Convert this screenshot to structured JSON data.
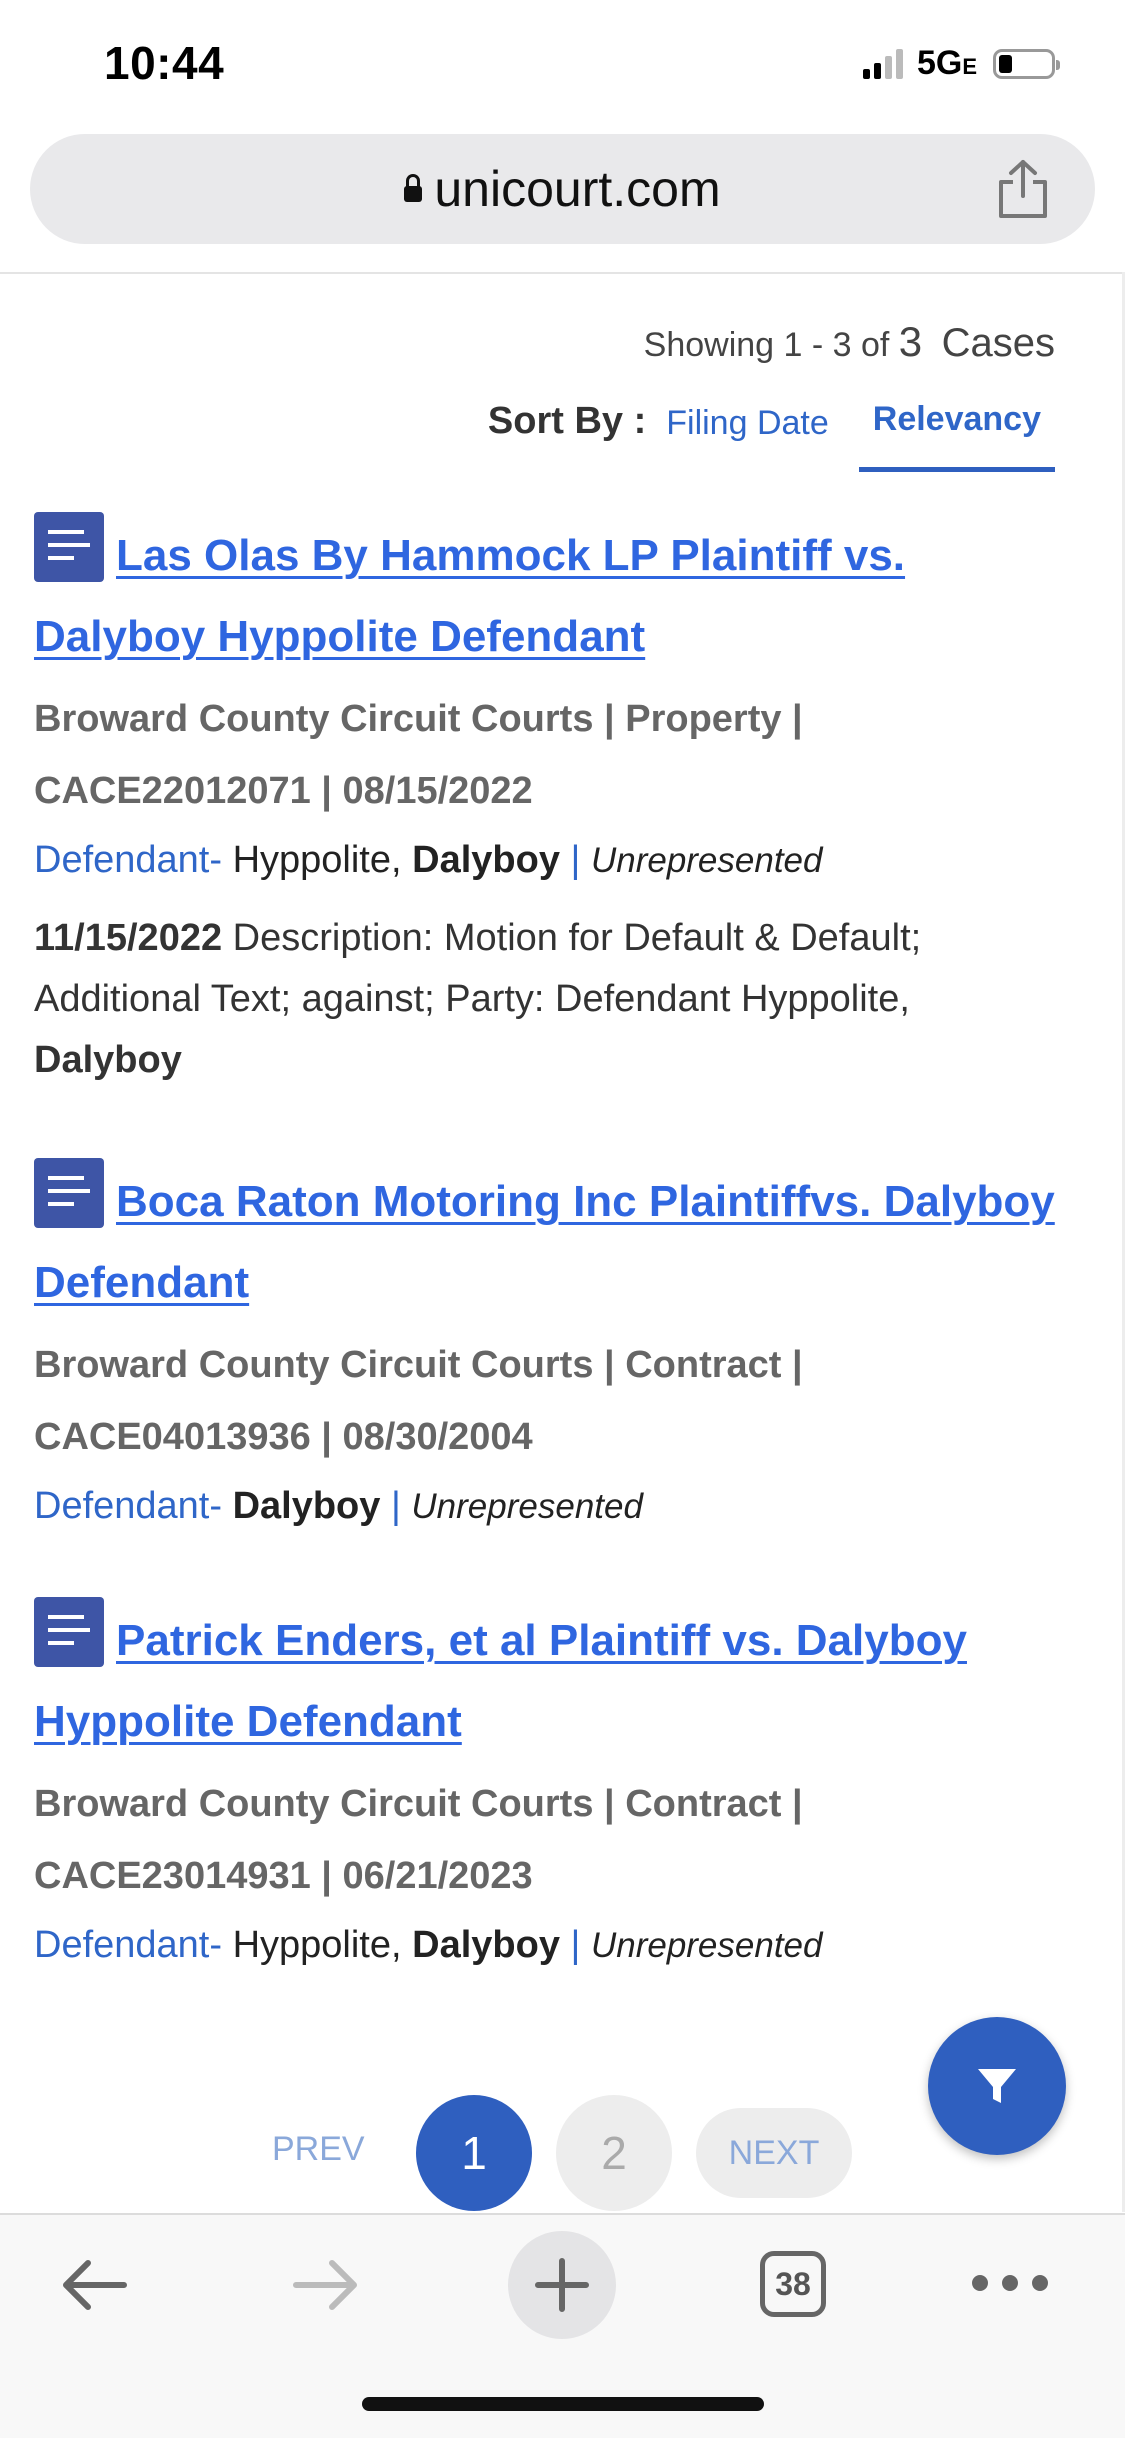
{
  "status_bar": {
    "time": "10:44",
    "network": "5G",
    "network_suffix": "E"
  },
  "browser": {
    "url": "unicourt.com"
  },
  "results": {
    "showing_prefix": "Showing 1 - 3 of",
    "total": "3",
    "unit": "Cases",
    "sort_label": "Sort By :",
    "sort_options": [
      "Filing Date",
      "Relevancy"
    ],
    "active_sort": "Relevancy"
  },
  "cases": [
    {
      "title_line1": "Las Olas By Hammock LP Plaintiff vs.",
      "title_line2": "Dalyboy Hyppolite Defendant",
      "court": "Broward County Circuit Courts",
      "category": "Property",
      "case_number": "CACE22012071",
      "date": "08/15/2022",
      "role": "Defendant-",
      "party_prefix": "Hyppolite,",
      "party_bold": "Dalyboy",
      "representation": "Unrepresented",
      "entry_date": "11/15/2022",
      "entry_line1": "Description: Motion for Default & Default;",
      "entry_line2": "Additional Text; against; Party: Defendant Hyppolite,",
      "entry_line3": "Dalyboy"
    },
    {
      "title_line1": "Boca Raton Motoring Inc Plaintiffvs. Dalyboy",
      "title_line2": "Defendant",
      "court": "Broward County Circuit Courts",
      "category": "Contract",
      "case_number": "CACE04013936",
      "date": "08/30/2004",
      "role": "Defendant-",
      "party_prefix": "",
      "party_bold": "Dalyboy",
      "representation": "Unrepresented"
    },
    {
      "title_line1": "Patrick Enders, et al Plaintiff vs. Dalyboy",
      "title_line2": "Hyppolite Defendant",
      "court": "Broward County Circuit Courts",
      "category": "Contract",
      "case_number": "CACE23014931",
      "date": "06/21/2023",
      "role": "Defendant-",
      "party_prefix": "Hyppolite,",
      "party_bold": "Dalyboy",
      "representation": "Unrepresented"
    }
  ],
  "pagination": {
    "prev": "PREV",
    "pages": [
      "1",
      "2"
    ],
    "current": "1",
    "next": "NEXT"
  },
  "toolbar": {
    "tab_count": "38"
  },
  "icons": {
    "filter": "filter-icon",
    "share": "share-icon",
    "lock": "lock-icon",
    "case": "document-icon"
  },
  "colors": {
    "accent": "#2f5fbf",
    "link": "#2f66e0",
    "doc_icon": "#3e55a6"
  }
}
